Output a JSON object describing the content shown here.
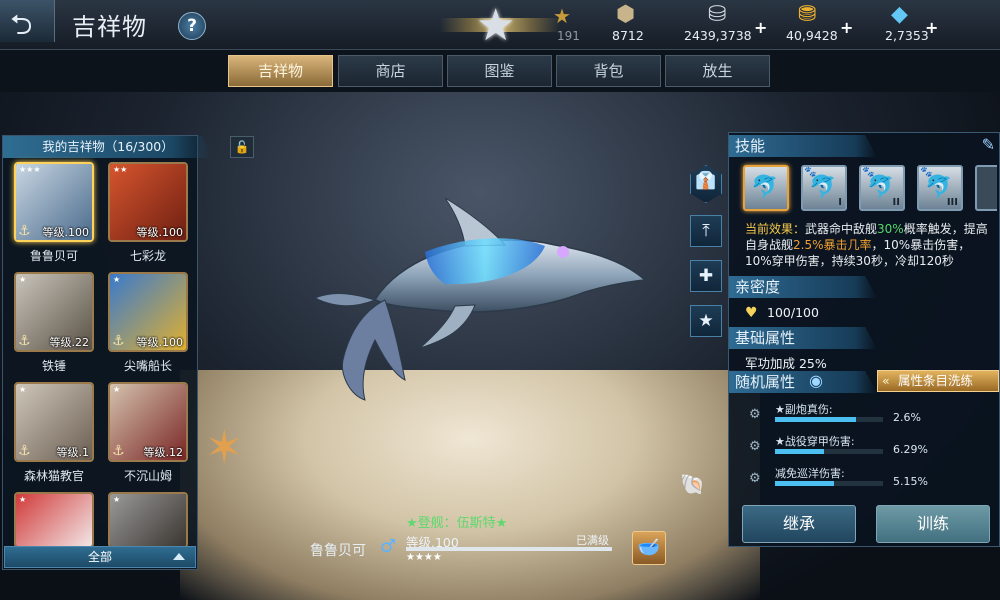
{
  "header": {
    "title": "吉祥物",
    "rank_count": "191",
    "currencies": [
      {
        "icon": "medal-icon",
        "value": "8712",
        "has_plus": false
      },
      {
        "icon": "silver-coin-icon",
        "value": "2439,3738",
        "has_plus": true
      },
      {
        "icon": "gold-coin-icon",
        "value": "40,9428",
        "has_plus": true
      },
      {
        "icon": "diamond-icon",
        "value": "2,7353",
        "has_plus": true
      }
    ]
  },
  "tabs": [
    "吉祥物",
    "商店",
    "图鉴",
    "背包",
    "放生"
  ],
  "active_tab": 0,
  "mascot_list": {
    "title": "我的吉祥物（16/300）",
    "filter": "全部",
    "pets": [
      {
        "name": "鲁鲁贝可",
        "level": "等级.100",
        "stars": "★★★",
        "selected": true,
        "anchor": true,
        "icon": "dolphin-icon"
      },
      {
        "name": "七彩龙",
        "level": "等级.100",
        "stars": "★★",
        "selected": false,
        "anchor": false,
        "icon": "chameleon-icon"
      },
      {
        "name": "铁锤",
        "level": "等级.22",
        "stars": "★",
        "selected": false,
        "anchor": true,
        "icon": "husky-icon"
      },
      {
        "name": "尖嘴船长",
        "level": "等级.100",
        "stars": "★",
        "selected": false,
        "anchor": true,
        "icon": "parrot-icon"
      },
      {
        "name": "森林猫教官",
        "level": "等级.1",
        "stars": "★",
        "selected": false,
        "anchor": true,
        "icon": "cat-icon"
      },
      {
        "name": "不沉山姆",
        "level": "等级.12",
        "stars": "★",
        "selected": false,
        "anchor": true,
        "icon": "hat-cat-icon"
      },
      {
        "name": "",
        "level": "",
        "stars": "★",
        "selected": false,
        "anchor": false,
        "icon": "santa-cat-icon"
      },
      {
        "name": "",
        "level": "",
        "stars": "★",
        "selected": false,
        "anchor": false,
        "icon": "dog-icon"
      }
    ]
  },
  "current_mascot": {
    "name": "鲁鲁贝可",
    "ship": "★登舰：伍斯特★",
    "level": "等级.100",
    "max_label": "已满级",
    "stars": "★★★★"
  },
  "skills": {
    "title": "技能",
    "icons": [
      {
        "name": "dolphin-skill-icon",
        "roman": "",
        "selected": true
      },
      {
        "name": "dolphin-skill-icon",
        "roman": "I",
        "selected": false
      },
      {
        "name": "dolphin-skill-icon",
        "roman": "II",
        "selected": false
      },
      {
        "name": "dolphin-skill-icon",
        "roman": "III",
        "selected": false
      }
    ],
    "effect_label": "当前效果：",
    "effect_text_1": "武器命中敌舰",
    "effect_pct_1": "30%",
    "effect_text_2": "概率触发，提高自身战舰",
    "effect_pct_2": "2.5%暴击几率",
    "effect_text_3": "，10%暴击伤害，10%穿甲伤害，持续30秒，冷却120秒"
  },
  "intimacy": {
    "title": "亲密度",
    "value": "100/100"
  },
  "base_attr": {
    "title": "基础属性",
    "text": "军功加成 25%"
  },
  "random_attr": {
    "title": "随机属性",
    "wash_button": "属性条目洗练",
    "rows": [
      {
        "label": "★副炮真伤:",
        "value": "2.6%",
        "fill": 0.75
      },
      {
        "label": "★战役穿甲伤害:",
        "value": "6.29%",
        "fill": 0.45
      },
      {
        "label": "减免巡洋伤害:",
        "value": "5.15%",
        "fill": 0.55
      }
    ]
  },
  "buttons": {
    "inherit": "继承",
    "train": "训练"
  },
  "colors": {
    "accent_gold": "#d9b57a",
    "panel_blue": "#2e6b93",
    "highlight_green": "#54d86a",
    "highlight_orange": "#f0a030"
  }
}
